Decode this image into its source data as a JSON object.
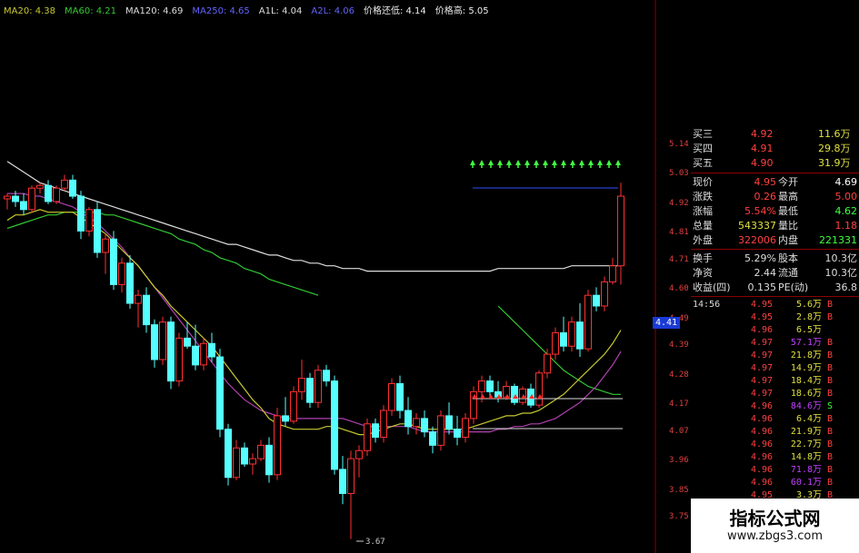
{
  "legend": [
    {
      "text": "MA20: 4.38",
      "color": "#c8c832"
    },
    {
      "text": "MA60: 4.21",
      "color": "#32c832"
    },
    {
      "text": "MA120: 4.69",
      "color": "#dddddd"
    },
    {
      "text": "MA250: 4.65",
      "color": "#6464ff"
    },
    {
      "text": "A1L: 4.04",
      "color": "#dddddd"
    },
    {
      "text": "A2L: 4.06",
      "color": "#6464ff"
    },
    {
      "text": "价格还低: 4.14",
      "color": "#eeeeee"
    },
    {
      "text": "价格高: 5.05",
      "color": "#eeeeee"
    }
  ],
  "axis_ticks": [
    "5.14",
    "5.03",
    "4.92",
    "4.81",
    "4.71",
    "4.60",
    "4.49",
    "4.39",
    "4.28",
    "4.17",
    "4.07",
    "3.96",
    "3.85",
    "3.75"
  ],
  "current_price_tag": "4.41",
  "low_label": "3.67",
  "order_book": [
    {
      "label": "买三",
      "price": "4.92",
      "vol": "11.6万"
    },
    {
      "label": "买四",
      "price": "4.91",
      "vol": "29.8万"
    },
    {
      "label": "买五",
      "price": "4.90",
      "vol": "31.9万"
    }
  ],
  "quote_rows": [
    {
      "l1": "现价",
      "v1": "4.95",
      "c1": "#ff4040",
      "l2": "今开",
      "v2": "4.69",
      "c2": "#ffffff"
    },
    {
      "l1": "涨跌",
      "v1": "0.26",
      "c1": "#ff4040",
      "l2": "最高",
      "v2": "5.00",
      "c2": "#ff4040"
    },
    {
      "l1": "涨幅",
      "v1": "5.54%",
      "c1": "#ff4040",
      "l2": "最低",
      "v2": "4.62",
      "c2": "#40ff40"
    },
    {
      "l1": "总量",
      "v1": "543337",
      "c1": "#e0e040",
      "l2": "量比",
      "v2": "1.18",
      "c2": "#ff4040"
    },
    {
      "l1": "外盘",
      "v1": "322006",
      "c1": "#ff4040",
      "l2": "内盘",
      "v2": "221331",
      "c2": "#40ff40"
    }
  ],
  "stat_rows": [
    {
      "l1": "换手",
      "v1": "5.29%",
      "l2": "股本",
      "v2": "10.3亿"
    },
    {
      "l1": "净资",
      "v1": "2.44",
      "l2": "流通",
      "v2": "10.3亿"
    },
    {
      "l1": "收益(四)",
      "v1": "0.135",
      "l2": "PE(动)",
      "v2": "36.8"
    }
  ],
  "ticks": [
    {
      "time": "14:56",
      "price": "4.95",
      "vol": "5.6万",
      "side": "B"
    },
    {
      "time": "",
      "price": "4.95",
      "vol": "2.8万",
      "side": "B"
    },
    {
      "time": "",
      "price": "4.96",
      "vol": "6.5万",
      "side": ""
    },
    {
      "time": "",
      "price": "4.97",
      "vol": "57.1万",
      "side": "B"
    },
    {
      "time": "",
      "price": "4.97",
      "vol": "21.8万",
      "side": "B"
    },
    {
      "time": "",
      "price": "4.97",
      "vol": "14.9万",
      "side": "B"
    },
    {
      "time": "",
      "price": "4.97",
      "vol": "18.4万",
      "side": "B"
    },
    {
      "time": "",
      "price": "4.97",
      "vol": "18.6万",
      "side": "B"
    },
    {
      "time": "",
      "price": "4.96",
      "vol": "84.6万",
      "side": "S"
    },
    {
      "time": "",
      "price": "4.96",
      "vol": "6.4万",
      "side": "B"
    },
    {
      "time": "",
      "price": "4.96",
      "vol": "21.9万",
      "side": "B"
    },
    {
      "time": "",
      "price": "4.96",
      "vol": "22.7万",
      "side": "B"
    },
    {
      "time": "",
      "price": "4.96",
      "vol": "14.8万",
      "side": "B"
    },
    {
      "time": "",
      "price": "4.96",
      "vol": "71.8万",
      "side": "B"
    },
    {
      "time": "",
      "price": "4.96",
      "vol": "60.1万",
      "side": "B"
    },
    {
      "time": "",
      "price": "4.95",
      "vol": "3.3万",
      "side": "B"
    }
  ],
  "watermark": {
    "title": "指标公式网",
    "url": "www.zbgs3.com"
  },
  "colors": {
    "up": "#ff3030",
    "down": "#55ffff",
    "ma20": "#c8c832",
    "ma60": "#32c832",
    "ma120": "#dddddd",
    "ma250": "#b040b0"
  },
  "chart_data": {
    "type": "candlestick",
    "price_range": [
      3.67,
      5.05
    ],
    "candles": [
      [
        4.94,
        4.96,
        4.9,
        4.95
      ],
      [
        4.95,
        4.97,
        4.91,
        4.93
      ],
      [
        4.93,
        4.96,
        4.88,
        4.9
      ],
      [
        4.9,
        4.99,
        4.89,
        4.98
      ],
      [
        4.98,
        5.0,
        4.96,
        4.99
      ],
      [
        4.99,
        5.01,
        4.92,
        4.93
      ],
      [
        4.93,
        4.99,
        4.92,
        4.98
      ],
      [
        4.98,
        5.03,
        4.97,
        5.01
      ],
      [
        5.01,
        5.03,
        4.94,
        4.95
      ],
      [
        4.95,
        4.97,
        4.79,
        4.82
      ],
      [
        4.82,
        4.91,
        4.8,
        4.9
      ],
      [
        4.9,
        4.93,
        4.72,
        4.74
      ],
      [
        4.74,
        4.81,
        4.66,
        4.79
      ],
      [
        4.79,
        4.82,
        4.6,
        4.62
      ],
      [
        4.62,
        4.72,
        4.59,
        4.7
      ],
      [
        4.7,
        4.73,
        4.53,
        4.55
      ],
      [
        4.55,
        4.6,
        4.46,
        4.58
      ],
      [
        4.58,
        4.61,
        4.44,
        4.47
      ],
      [
        4.47,
        4.49,
        4.31,
        4.34
      ],
      [
        4.34,
        4.5,
        4.32,
        4.48
      ],
      [
        4.48,
        4.5,
        4.23,
        4.26
      ],
      [
        4.26,
        4.44,
        4.24,
        4.42
      ],
      [
        4.42,
        4.48,
        4.38,
        4.39
      ],
      [
        4.39,
        4.47,
        4.3,
        4.32
      ],
      [
        4.32,
        4.42,
        4.3,
        4.4
      ],
      [
        4.4,
        4.44,
        4.33,
        4.35
      ],
      [
        4.35,
        4.38,
        4.05,
        4.08
      ],
      [
        4.08,
        4.1,
        3.87,
        3.9
      ],
      [
        3.9,
        4.04,
        3.89,
        4.01
      ],
      [
        4.01,
        4.03,
        3.94,
        3.95
      ],
      [
        3.95,
        3.99,
        3.91,
        3.97
      ],
      [
        3.97,
        4.04,
        3.96,
        4.02
      ],
      [
        4.02,
        4.05,
        3.88,
        3.91
      ],
      [
        3.91,
        4.16,
        3.89,
        4.13
      ],
      [
        4.13,
        4.2,
        4.09,
        4.11
      ],
      [
        4.11,
        4.24,
        4.1,
        4.22
      ],
      [
        4.22,
        4.34,
        4.19,
        4.27
      ],
      [
        4.27,
        4.29,
        4.16,
        4.18
      ],
      [
        4.18,
        4.32,
        4.16,
        4.3
      ],
      [
        4.3,
        4.32,
        4.24,
        4.26
      ],
      [
        4.26,
        4.28,
        3.91,
        3.93
      ],
      [
        3.93,
        3.98,
        3.8,
        3.84
      ],
      [
        3.84,
        4.0,
        3.67,
        3.97
      ],
      [
        3.97,
        4.02,
        3.9,
        4.0
      ],
      [
        4.0,
        4.12,
        3.98,
        4.1
      ],
      [
        4.1,
        4.12,
        4.03,
        4.05
      ],
      [
        4.05,
        4.17,
        4.03,
        4.15
      ],
      [
        4.15,
        4.27,
        4.13,
        4.25
      ],
      [
        4.25,
        4.28,
        4.12,
        4.15
      ],
      [
        4.15,
        4.2,
        4.06,
        4.09
      ],
      [
        4.09,
        4.14,
        4.06,
        4.12
      ],
      [
        4.12,
        4.15,
        4.05,
        4.07
      ],
      [
        4.07,
        4.09,
        3.99,
        4.02
      ],
      [
        4.02,
        4.15,
        4.0,
        4.13
      ],
      [
        4.13,
        4.18,
        4.06,
        4.08
      ],
      [
        4.08,
        4.13,
        4.02,
        4.05
      ],
      [
        4.05,
        4.14,
        4.03,
        4.12
      ],
      [
        4.12,
        4.24,
        4.1,
        4.22
      ],
      [
        4.22,
        4.28,
        4.18,
        4.26
      ],
      [
        4.26,
        4.28,
        4.2,
        4.22
      ],
      [
        4.22,
        4.26,
        4.18,
        4.2
      ],
      [
        4.2,
        4.26,
        4.19,
        4.24
      ],
      [
        4.24,
        4.25,
        4.17,
        4.18
      ],
      [
        4.18,
        4.24,
        4.17,
        4.23
      ],
      [
        4.23,
        4.25,
        4.16,
        4.17
      ],
      [
        4.17,
        4.3,
        4.16,
        4.29
      ],
      [
        4.29,
        4.38,
        4.27,
        4.36
      ],
      [
        4.36,
        4.46,
        4.34,
        4.44
      ],
      [
        4.44,
        4.5,
        4.37,
        4.39
      ],
      [
        4.39,
        4.5,
        4.37,
        4.48
      ],
      [
        4.48,
        4.55,
        4.35,
        4.38
      ],
      [
        4.38,
        4.6,
        4.37,
        4.58
      ],
      [
        4.58,
        4.61,
        4.52,
        4.54
      ],
      [
        4.54,
        4.65,
        4.52,
        4.63
      ],
      [
        4.63,
        4.72,
        4.62,
        4.69
      ],
      [
        4.69,
        5.0,
        4.62,
        4.95
      ]
    ],
    "ma20": [
      4.86,
      4.88,
      4.88,
      4.89,
      4.9,
      4.89,
      4.89,
      4.89,
      4.89,
      4.87,
      4.85,
      4.83,
      4.81,
      4.78,
      4.75,
      4.72,
      4.69,
      4.65,
      4.61,
      4.58,
      4.54,
      4.51,
      4.48,
      4.45,
      4.42,
      4.39,
      4.35,
      4.31,
      4.27,
      4.23,
      4.19,
      4.16,
      4.12,
      4.1,
      4.09,
      4.08,
      4.08,
      4.08,
      4.08,
      4.09,
      4.09,
      4.08,
      4.07,
      4.06,
      4.06,
      4.07,
      4.08,
      4.09,
      4.1,
      4.1,
      4.09,
      4.08,
      4.08,
      4.08,
      4.08,
      4.08,
      4.08,
      4.09,
      4.1,
      4.11,
      4.12,
      4.13,
      4.13,
      4.14,
      4.14,
      4.15,
      4.17,
      4.19,
      4.21,
      4.24,
      4.27,
      4.3,
      4.33,
      4.36,
      4.4,
      4.45
    ],
    "ma60": [
      4.83,
      4.84,
      4.85,
      4.86,
      4.87,
      4.88,
      4.88,
      4.89,
      4.89,
      4.89,
      4.89,
      4.89,
      4.88,
      4.88,
      4.87,
      4.86,
      4.85,
      4.84,
      4.83,
      4.82,
      4.81,
      4.79,
      4.78,
      4.77,
      4.75,
      4.74,
      4.72,
      4.71,
      4.7,
      4.68,
      4.67,
      4.66,
      4.64,
      4.63,
      4.62,
      4.61,
      4.6,
      4.59,
      4.58,
      null,
      null,
      null,
      null,
      null,
      null,
      null,
      null,
      null,
      null,
      null,
      null,
      null,
      null,
      null,
      null,
      null,
      null,
      null,
      null,
      null,
      4.54,
      4.51,
      4.48,
      4.45,
      4.42,
      4.39,
      4.36,
      4.33,
      4.3,
      4.28,
      4.26,
      4.24,
      4.23,
      4.22,
      4.21,
      4.21
    ],
    "ma120": [
      5.08,
      5.06,
      5.04,
      5.02,
      5.0,
      4.99,
      4.98,
      4.97,
      4.96,
      4.95,
      4.94,
      4.93,
      4.92,
      4.91,
      4.9,
      4.89,
      4.88,
      4.87,
      4.86,
      4.85,
      4.84,
      4.83,
      4.82,
      4.81,
      4.8,
      4.79,
      4.78,
      4.77,
      4.77,
      4.76,
      4.75,
      4.74,
      4.73,
      4.73,
      4.72,
      4.71,
      4.71,
      4.7,
      4.7,
      4.69,
      4.69,
      4.68,
      4.68,
      4.68,
      4.67,
      4.67,
      4.67,
      4.67,
      4.67,
      4.67,
      4.67,
      4.67,
      4.67,
      4.67,
      4.67,
      4.67,
      4.67,
      4.67,
      4.67,
      4.67,
      4.68,
      4.68,
      4.68,
      4.68,
      4.68,
      4.68,
      4.68,
      4.68,
      4.68,
      4.69,
      4.69,
      4.69,
      4.69,
      4.69,
      4.69,
      4.69
    ],
    "ma250": [
      4.96,
      4.96,
      4.96,
      4.95,
      4.95,
      4.94,
      4.93,
      4.92,
      4.91,
      4.89,
      4.87,
      4.85,
      4.82,
      4.79,
      4.76,
      4.72,
      4.69,
      4.65,
      4.61,
      4.57,
      4.53,
      4.49,
      4.45,
      4.41,
      4.37,
      4.33,
      4.29,
      4.25,
      4.22,
      4.19,
      4.17,
      4.15,
      4.14,
      4.13,
      4.12,
      4.12,
      4.12,
      4.12,
      4.12,
      4.12,
      4.12,
      4.12,
      4.11,
      4.1,
      4.09,
      4.09,
      4.09,
      4.09,
      4.09,
      4.09,
      4.08,
      4.07,
      4.07,
      4.07,
      4.07,
      4.07,
      4.07,
      4.07,
      4.07,
      4.07,
      4.08,
      4.08,
      4.09,
      4.09,
      4.1,
      4.1,
      4.11,
      4.12,
      4.14,
      4.16,
      4.18,
      4.21,
      4.24,
      4.28,
      4.32,
      4.37
    ],
    "level_lines": [
      5.05,
      4.14,
      4.04
    ]
  }
}
